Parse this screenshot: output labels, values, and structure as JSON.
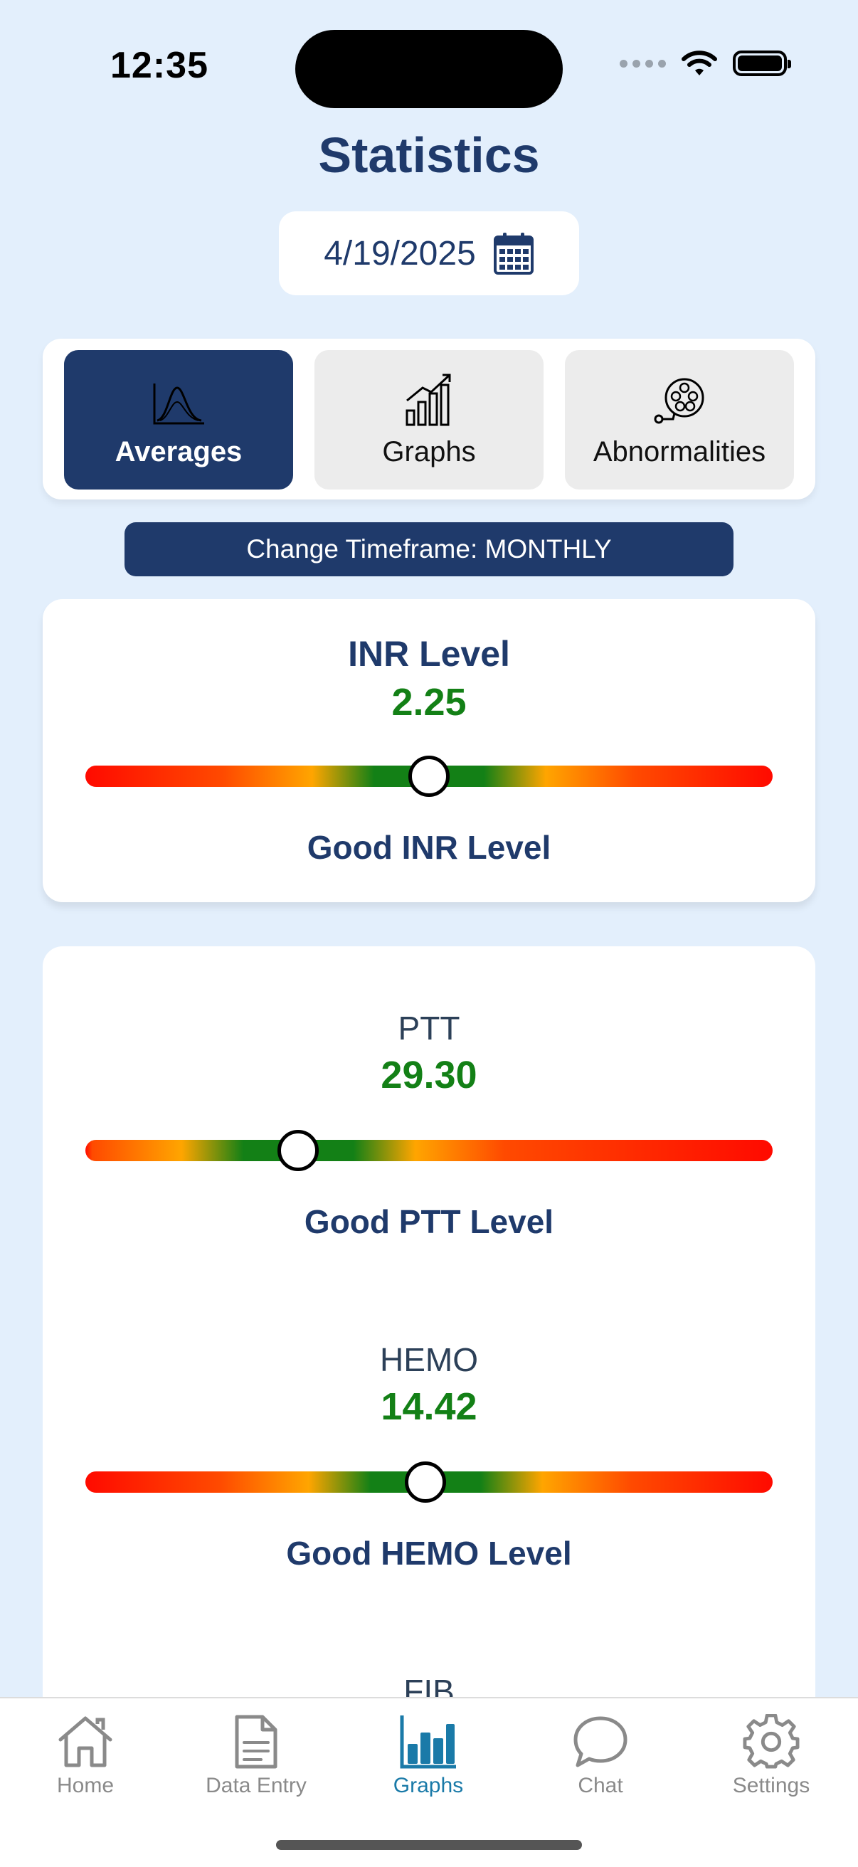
{
  "status_bar": {
    "time": "12:35"
  },
  "header": {
    "title": "Statistics"
  },
  "date_picker": {
    "value": "4/19/2025"
  },
  "tabs": [
    {
      "label": "Averages",
      "active": true
    },
    {
      "label": "Graphs",
      "active": false
    },
    {
      "label": "Abnormalities",
      "active": false
    }
  ],
  "timeframe_button": {
    "label": "Change Timeframe: MONTHLY"
  },
  "metrics": [
    {
      "name": "INR Level",
      "value": "2.25",
      "status": "Good INR Level",
      "position": 0.5
    },
    {
      "name": "PTT",
      "value": "29.30",
      "status": "Good PTT Level",
      "position": 0.31
    },
    {
      "name": "HEMO",
      "value": "14.42",
      "status": "Good HEMO Level",
      "position": 0.495
    },
    {
      "name": "FIB"
    }
  ],
  "bottom_nav": [
    {
      "label": "Home",
      "icon": "home-icon"
    },
    {
      "label": "Data Entry",
      "icon": "document-icon"
    },
    {
      "label": "Graphs",
      "icon": "bar-chart-icon",
      "active": true
    },
    {
      "label": "Chat",
      "icon": "chat-bubble-icon"
    },
    {
      "label": "Settings",
      "icon": "gear-icon"
    }
  ],
  "colors": {
    "primary": "#1f3a6b",
    "background": "#e3effc",
    "good_value": "#138016",
    "active_nav": "#1a7aa8"
  }
}
